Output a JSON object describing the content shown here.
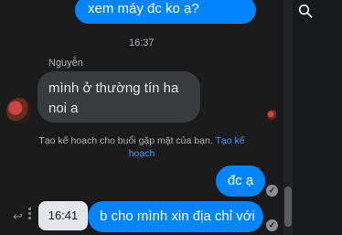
{
  "messages": {
    "top_outgoing": "xem máy đc ko ạ?",
    "timestamp": "16:37",
    "sender_name": "Nguyễn",
    "incoming": "mình ở thường tín ha noi a",
    "outgoing_1": "đc ạ",
    "outgoing_2": "b cho mình xin địa chỉ với"
  },
  "notice": {
    "text": "Tạo kế hoạch cho buổi gặp mặt của bạn.",
    "link": "Tạo kế hoạch"
  },
  "hover_time": "16:41",
  "colors": {
    "accent": "#0084ff",
    "incoming_bubble": "#3a3b3c",
    "background": "#1a1a1b"
  }
}
